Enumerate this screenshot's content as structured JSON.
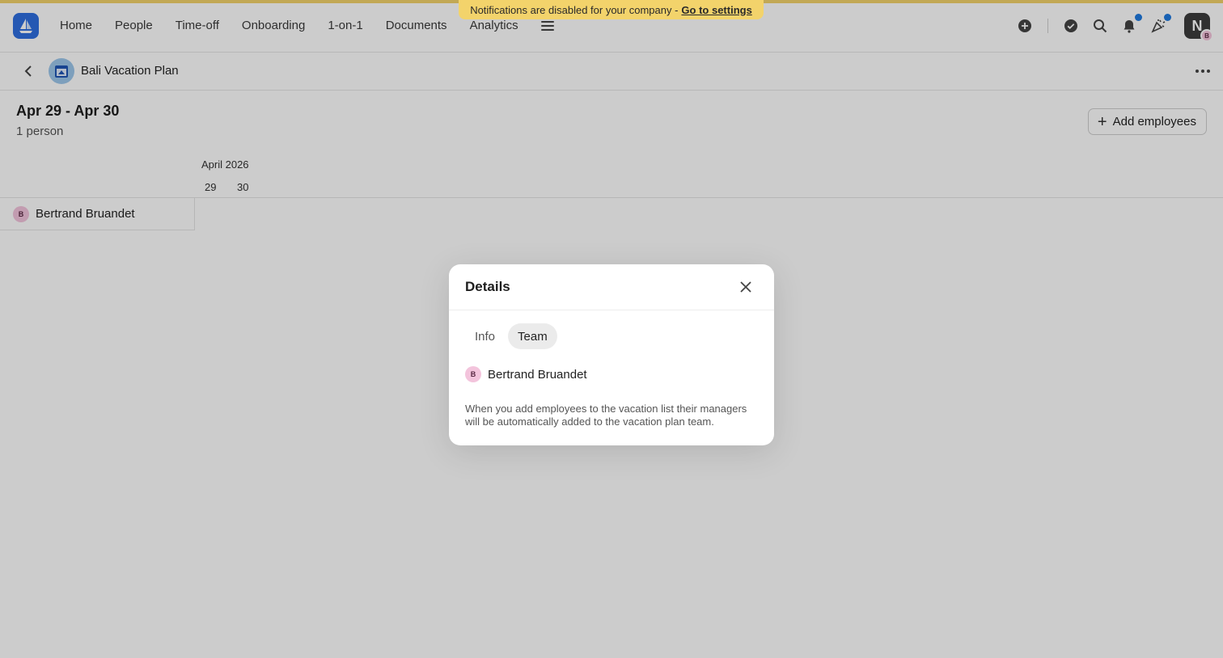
{
  "banner": {
    "text": "Notifications are disabled for your company -",
    "link": "Go to settings"
  },
  "nav": {
    "links": [
      "Home",
      "People",
      "Time-off",
      "Onboarding",
      "1-on-1",
      "Documents",
      "Analytics"
    ]
  },
  "user": {
    "initial": "N",
    "badge": "B"
  },
  "plan": {
    "title": "Bali Vacation Plan"
  },
  "summary": {
    "range": "Apr 29 - Apr 30",
    "people": "1 person",
    "add_label": "Add employees"
  },
  "calendar": {
    "month": "April 2026",
    "days": [
      "29",
      "30"
    ]
  },
  "employees": [
    {
      "initial": "B",
      "name": "Bertrand Bruandet"
    }
  ],
  "modal": {
    "title": "Details",
    "tabs": [
      "Info",
      "Team"
    ],
    "active_tab": "Team",
    "members": [
      {
        "initial": "B",
        "name": "Bertrand Bruandet"
      }
    ],
    "note": "When you add employees to the vacation list their managers will be automatically added to the vacation plan team."
  },
  "colors": {
    "accent": "#f3d36b",
    "brand": "#2f6fe0",
    "dot": "#1f7ae0"
  }
}
